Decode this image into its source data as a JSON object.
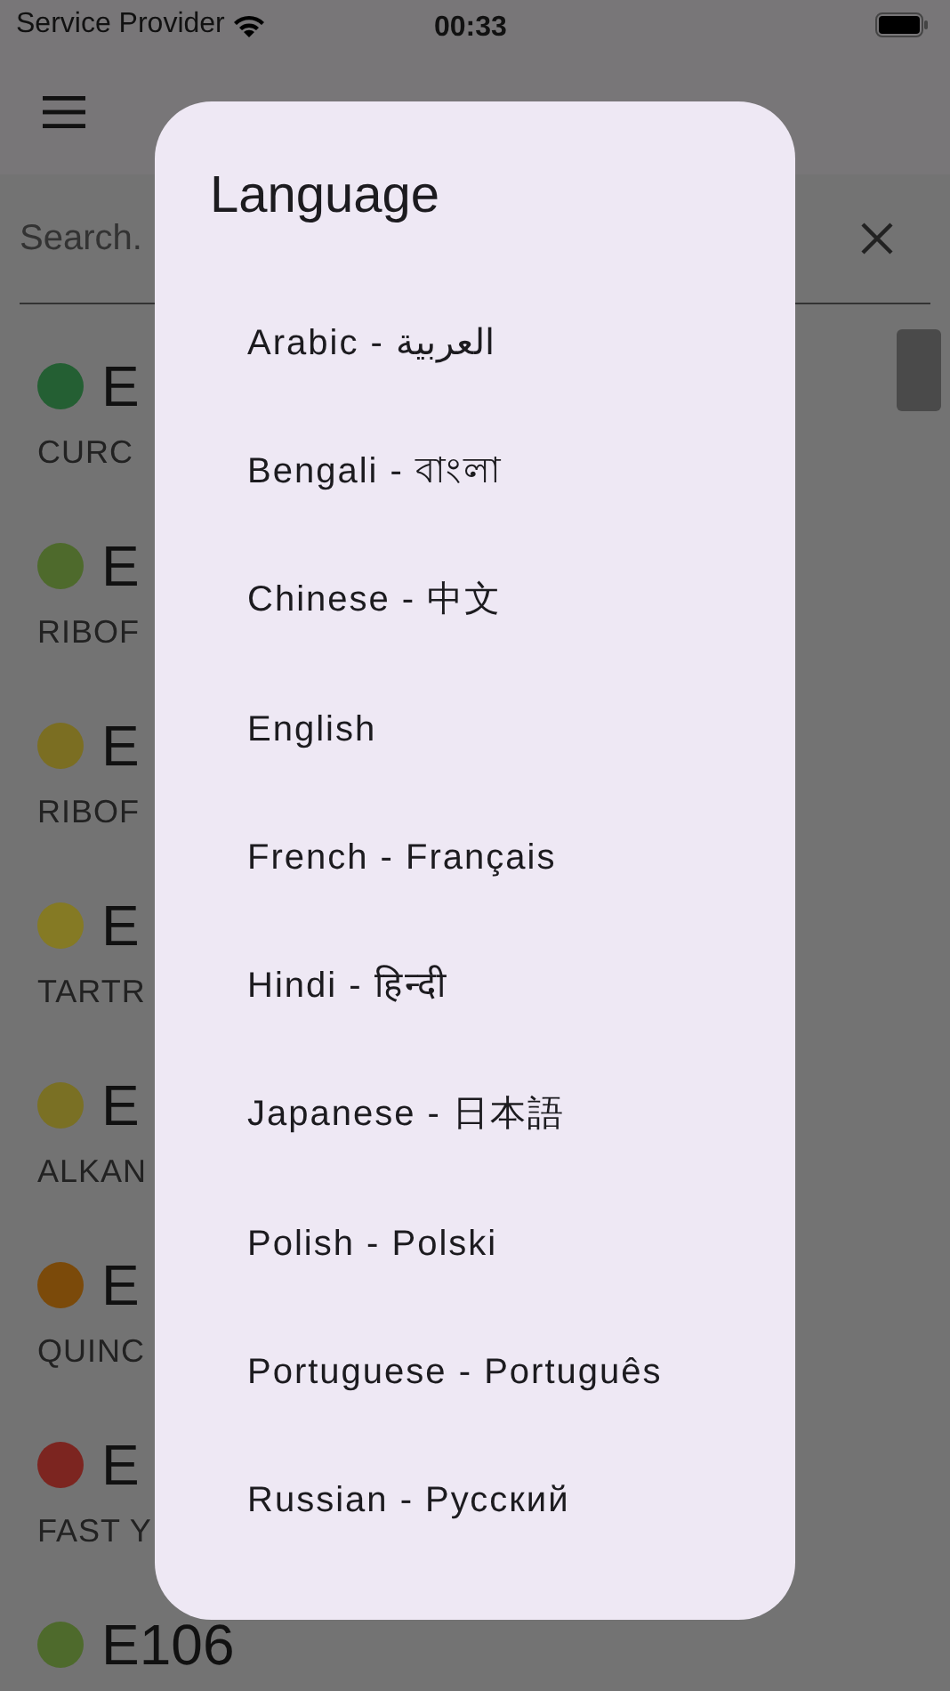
{
  "status_bar": {
    "carrier": "Service Provider",
    "time": "00:33"
  },
  "search": {
    "placeholder": "Search."
  },
  "items": [
    {
      "code": "E",
      "name": "CURC",
      "color": "#245f33"
    },
    {
      "code": "E",
      "name": "RIBOF",
      "color": "#4e6a2c"
    },
    {
      "code": "E",
      "name": "RIBOF",
      "color": "#7b6e22"
    },
    {
      "code": "E",
      "name": "TARTR",
      "color": "#857a24"
    },
    {
      "code": "E",
      "name": "ALKAN",
      "color": "#7a7024"
    },
    {
      "code": "E",
      "name": "QUINC",
      "color": "#7b4a0a"
    },
    {
      "code": "E",
      "name": "FAST Y",
      "color": "#7c2520"
    },
    {
      "code": "E106",
      "color": "#4e6a2c"
    }
  ],
  "dialog": {
    "title": "Language",
    "options": [
      "Arabic - العربية",
      "Bengali - বাংলা",
      "Chinese - 中文",
      "English",
      "French - Français",
      "Hindi - हिन्दी",
      "Japanese - 日本語",
      "Polish - Polski",
      "Portuguese - Português",
      "Russian - Русский"
    ]
  }
}
